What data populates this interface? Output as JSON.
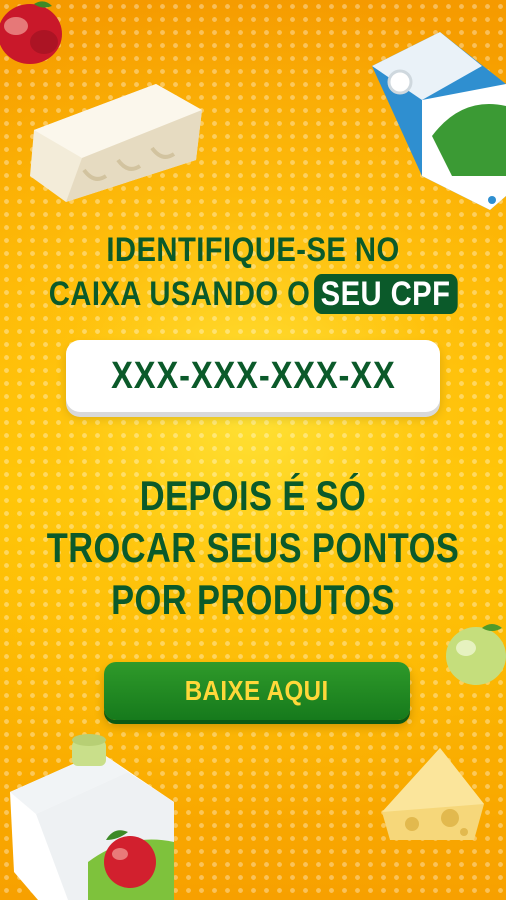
{
  "banner": {
    "headline_line1": "IDENTIFIQUE-SE NO",
    "headline_line2_prefix": "CAIXA USANDO O",
    "headline_line2_highlight": "SEU CPF",
    "cpf_placeholder": "XXX-XXX-XXX-XX",
    "subhead_line1": "DEPOIS É SÓ",
    "subhead_line2": "TROCAR SEUS PONTOS",
    "subhead_line3": "POR PRODUTOS",
    "cta_label": "BAIXE AQUI"
  },
  "colors": {
    "background": "#f7a400",
    "text_green": "#0b5a2a",
    "button_green": "#1f8a22",
    "button_text": "#ffd83a"
  },
  "icons": [
    "apple-icon",
    "tofu-icon",
    "milk-carton-icon",
    "green-apple-icon",
    "juice-carton-icon",
    "cheese-icon"
  ]
}
